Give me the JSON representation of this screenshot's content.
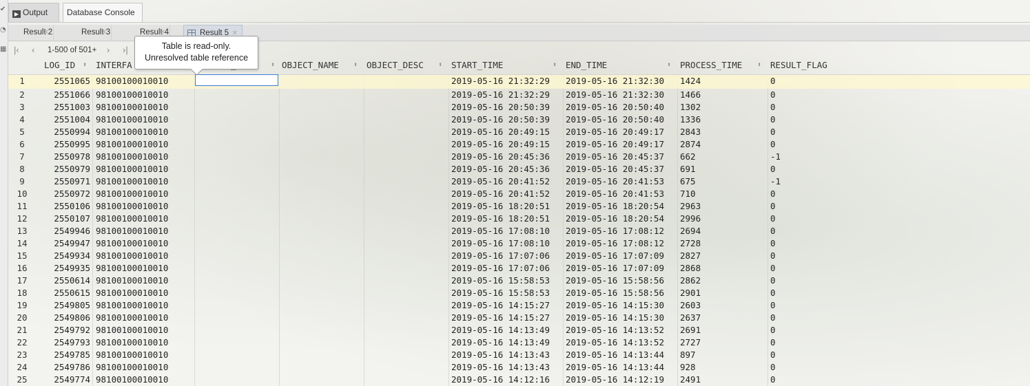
{
  "tool_tabs": {
    "output": "Output",
    "console": "Database Console"
  },
  "result_tabs": [
    {
      "label": "Result 2",
      "active": false
    },
    {
      "label": "Result 3",
      "active": false
    },
    {
      "label": "Result 4",
      "active": false
    },
    {
      "label": "Result 5",
      "active": true
    }
  ],
  "toolbar": {
    "pager": "1-500 of 501+"
  },
  "tooltip": {
    "line1": "Table is read-only.",
    "line2": "Unresolved table reference"
  },
  "columns": [
    {
      "name": "LOG_ID"
    },
    {
      "name": "INTERFA"
    },
    {
      "name": "_"
    },
    {
      "name": "OBJECT_NAME"
    },
    {
      "name": "OBJECT_DESC"
    },
    {
      "name": "START_TIME"
    },
    {
      "name": "END_TIME"
    },
    {
      "name": "PROCESS_TIME"
    },
    {
      "name": "RESULT_FLAG"
    }
  ],
  "rows": [
    {
      "n": "1",
      "log_id": "2551065",
      "iface": "98100100010010",
      "start": "2019-05-16 21:32:29",
      "end": "2019-05-16 21:32:30",
      "proc": "1424",
      "flag": "0"
    },
    {
      "n": "2",
      "log_id": "2551066",
      "iface": "98100100010010",
      "start": "2019-05-16 21:32:29",
      "end": "2019-05-16 21:32:30",
      "proc": "1466",
      "flag": "0"
    },
    {
      "n": "3",
      "log_id": "2551003",
      "iface": "98100100010010",
      "start": "2019-05-16 20:50:39",
      "end": "2019-05-16 20:50:40",
      "proc": "1302",
      "flag": "0"
    },
    {
      "n": "4",
      "log_id": "2551004",
      "iface": "98100100010010",
      "start": "2019-05-16 20:50:39",
      "end": "2019-05-16 20:50:40",
      "proc": "1336",
      "flag": "0"
    },
    {
      "n": "5",
      "log_id": "2550994",
      "iface": "98100100010010",
      "start": "2019-05-16 20:49:15",
      "end": "2019-05-16 20:49:17",
      "proc": "2843",
      "flag": "0"
    },
    {
      "n": "6",
      "log_id": "2550995",
      "iface": "98100100010010",
      "start": "2019-05-16 20:49:15",
      "end": "2019-05-16 20:49:17",
      "proc": "2874",
      "flag": "0"
    },
    {
      "n": "7",
      "log_id": "2550978",
      "iface": "98100100010010",
      "start": "2019-05-16 20:45:36",
      "end": "2019-05-16 20:45:37",
      "proc": "662",
      "flag": "-1"
    },
    {
      "n": "8",
      "log_id": "2550979",
      "iface": "98100100010010",
      "start": "2019-05-16 20:45:36",
      "end": "2019-05-16 20:45:37",
      "proc": "691",
      "flag": "0"
    },
    {
      "n": "9",
      "log_id": "2550971",
      "iface": "98100100010010",
      "start": "2019-05-16 20:41:52",
      "end": "2019-05-16 20:41:53",
      "proc": "675",
      "flag": "-1"
    },
    {
      "n": "10",
      "log_id": "2550972",
      "iface": "98100100010010",
      "start": "2019-05-16 20:41:52",
      "end": "2019-05-16 20:41:53",
      "proc": "710",
      "flag": "0"
    },
    {
      "n": "11",
      "log_id": "2550106",
      "iface": "98100100010010",
      "start": "2019-05-16 18:20:51",
      "end": "2019-05-16 18:20:54",
      "proc": "2963",
      "flag": "0"
    },
    {
      "n": "12",
      "log_id": "2550107",
      "iface": "98100100010010",
      "start": "2019-05-16 18:20:51",
      "end": "2019-05-16 18:20:54",
      "proc": "2996",
      "flag": "0"
    },
    {
      "n": "13",
      "log_id": "2549946",
      "iface": "98100100010010",
      "start": "2019-05-16 17:08:10",
      "end": "2019-05-16 17:08:12",
      "proc": "2694",
      "flag": "0"
    },
    {
      "n": "14",
      "log_id": "2549947",
      "iface": "98100100010010",
      "start": "2019-05-16 17:08:10",
      "end": "2019-05-16 17:08:12",
      "proc": "2728",
      "flag": "0"
    },
    {
      "n": "15",
      "log_id": "2549934",
      "iface": "98100100010010",
      "start": "2019-05-16 17:07:06",
      "end": "2019-05-16 17:07:09",
      "proc": "2827",
      "flag": "0"
    },
    {
      "n": "16",
      "log_id": "2549935",
      "iface": "98100100010010",
      "start": "2019-05-16 17:07:06",
      "end": "2019-05-16 17:07:09",
      "proc": "2868",
      "flag": "0"
    },
    {
      "n": "17",
      "log_id": "2550614",
      "iface": "98100100010010",
      "start": "2019-05-16 15:58:53",
      "end": "2019-05-16 15:58:56",
      "proc": "2862",
      "flag": "0"
    },
    {
      "n": "18",
      "log_id": "2550615",
      "iface": "98100100010010",
      "start": "2019-05-16 15:58:53",
      "end": "2019-05-16 15:58:56",
      "proc": "2901",
      "flag": "0"
    },
    {
      "n": "19",
      "log_id": "2549805",
      "iface": "98100100010010",
      "start": "2019-05-16 14:15:27",
      "end": "2019-05-16 14:15:30",
      "proc": "2603",
      "flag": "0"
    },
    {
      "n": "20",
      "log_id": "2549806",
      "iface": "98100100010010",
      "start": "2019-05-16 14:15:27",
      "end": "2019-05-16 14:15:30",
      "proc": "2637",
      "flag": "0"
    },
    {
      "n": "21",
      "log_id": "2549792",
      "iface": "98100100010010",
      "start": "2019-05-16 14:13:49",
      "end": "2019-05-16 14:13:52",
      "proc": "2691",
      "flag": "0"
    },
    {
      "n": "22",
      "log_id": "2549793",
      "iface": "98100100010010",
      "start": "2019-05-16 14:13:49",
      "end": "2019-05-16 14:13:52",
      "proc": "2727",
      "flag": "0"
    },
    {
      "n": "23",
      "log_id": "2549785",
      "iface": "98100100010010",
      "start": "2019-05-16 14:13:43",
      "end": "2019-05-16 14:13:44",
      "proc": "897",
      "flag": "0"
    },
    {
      "n": "24",
      "log_id": "2549786",
      "iface": "98100100010010",
      "start": "2019-05-16 14:13:43",
      "end": "2019-05-16 14:13:44",
      "proc": "928",
      "flag": "0"
    },
    {
      "n": "25",
      "log_id": "2549774",
      "iface": "98100100010010",
      "start": "2019-05-16 14:12:16",
      "end": "2019-05-16 14:12:19",
      "proc": "2491",
      "flag": "0"
    }
  ]
}
